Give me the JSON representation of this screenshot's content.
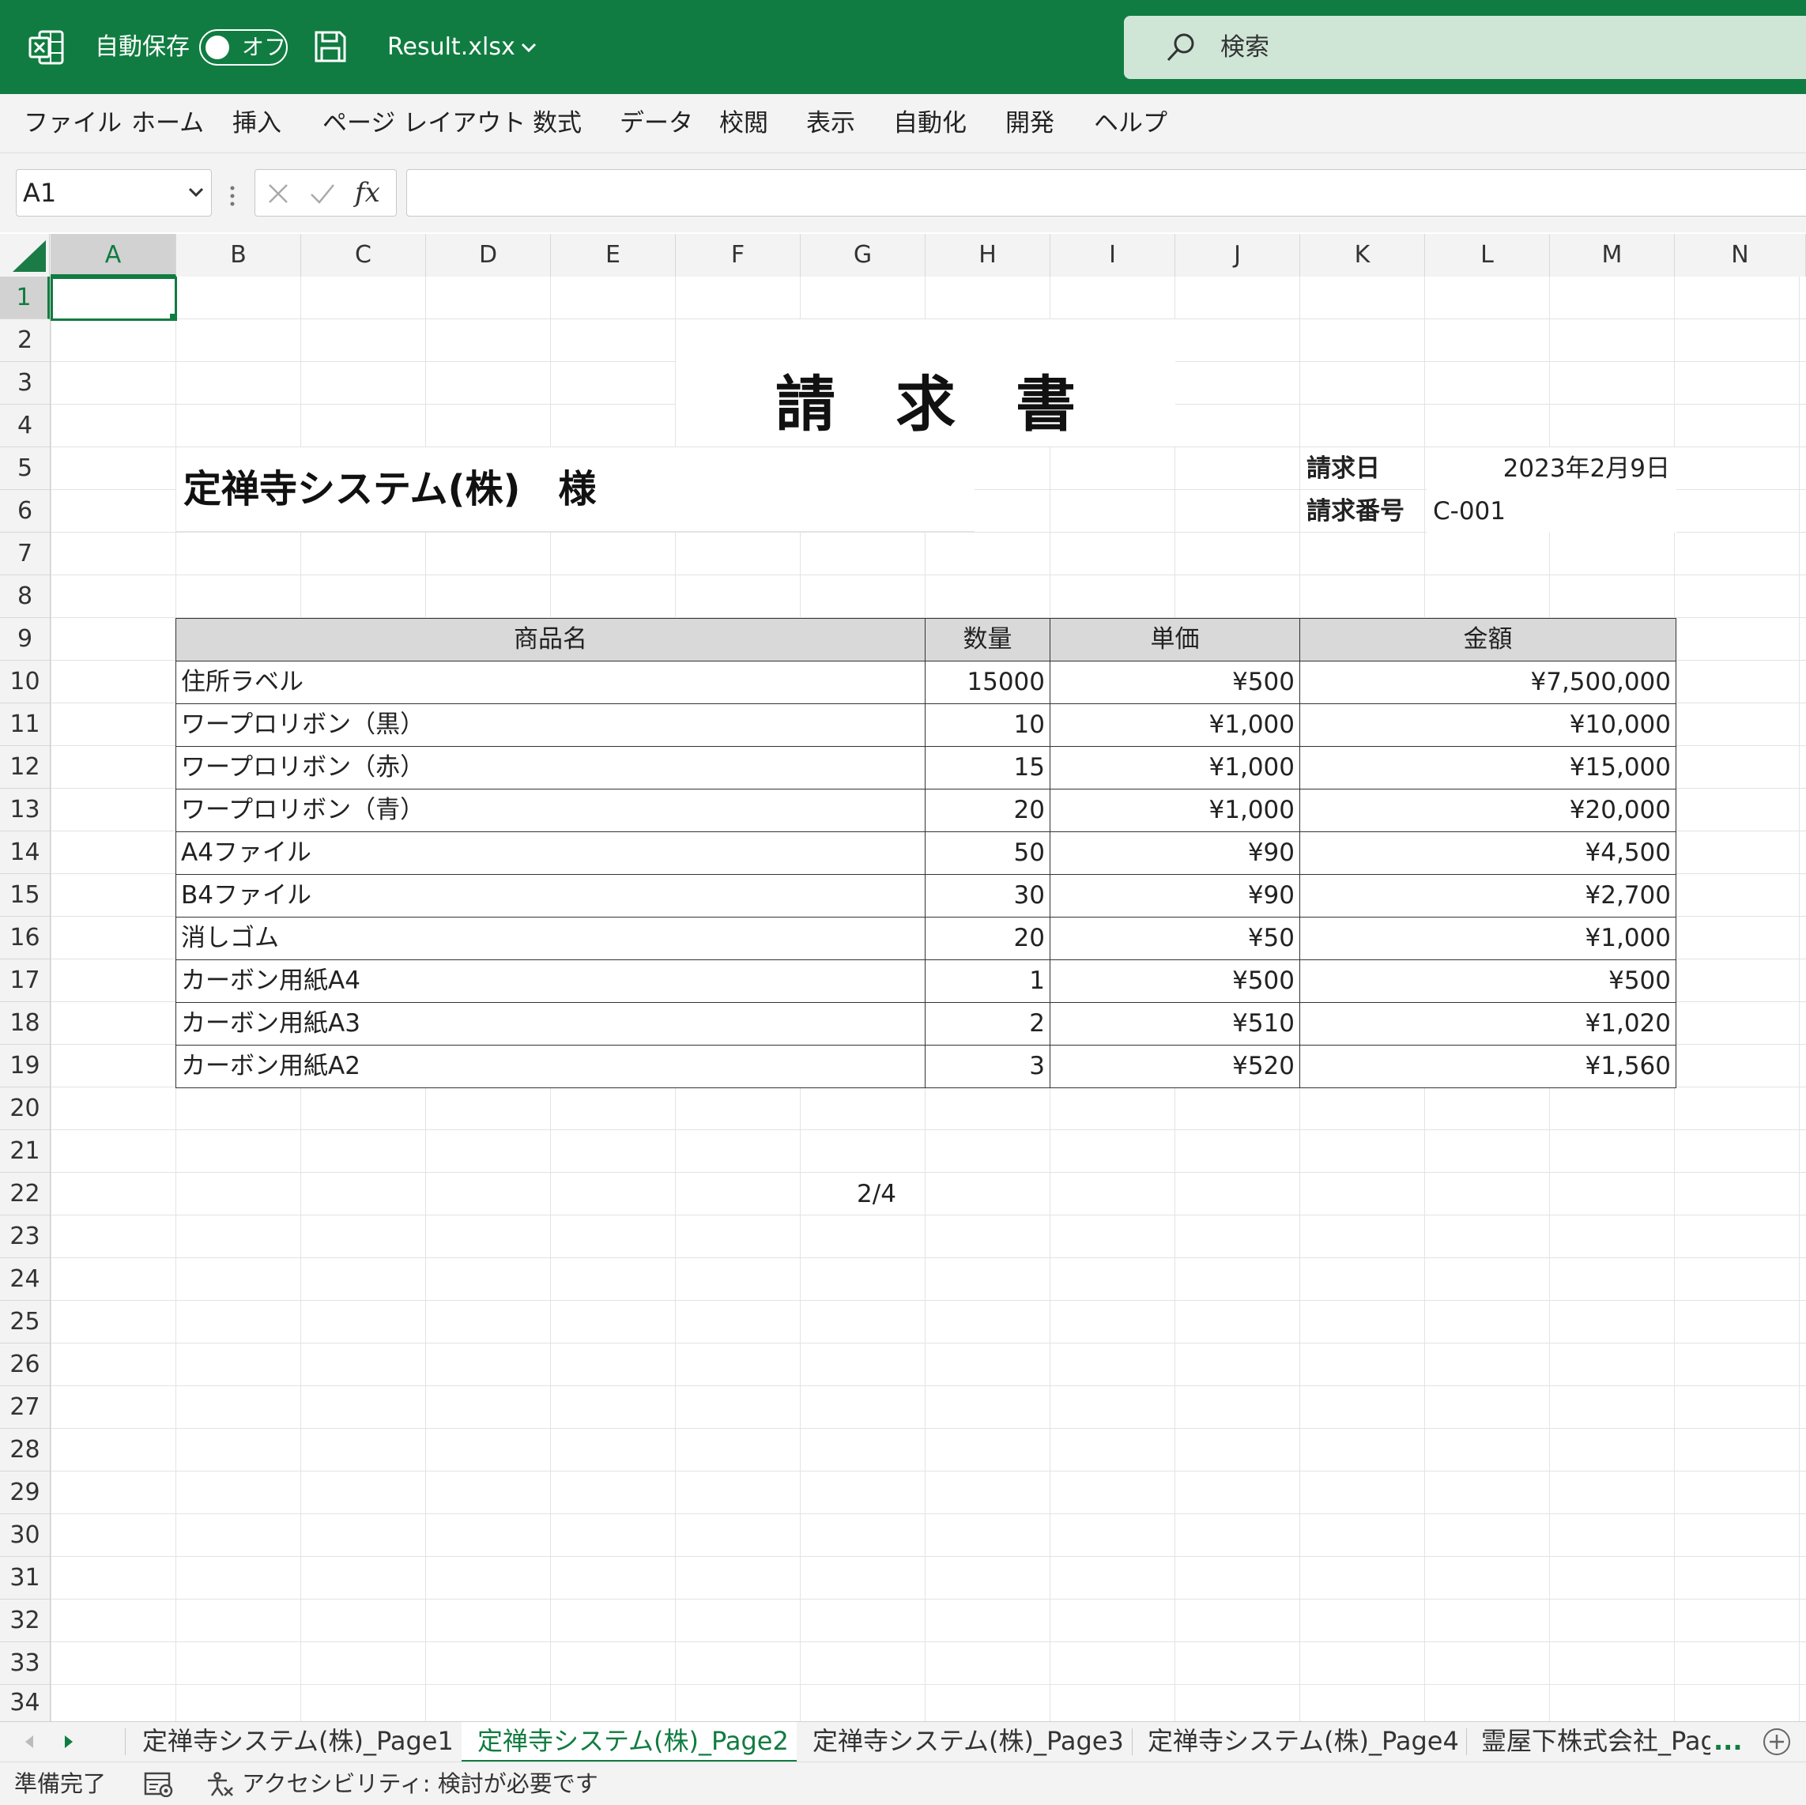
{
  "titlebar": {
    "autosave_label": "自動保存",
    "autosave_state": "オフ",
    "filename": "Result.xlsx",
    "search_placeholder": "検索"
  },
  "menu": [
    "ファイル",
    "ホーム",
    "挿入",
    "ページ レイアウト",
    "数式",
    "データ",
    "校閲",
    "表示",
    "自動化",
    "開発",
    "ヘルプ"
  ],
  "formula_bar": {
    "name_box": "A1",
    "fx": "fx",
    "formula": ""
  },
  "columns": [
    "A",
    "B",
    "C",
    "D",
    "E",
    "F",
    "G",
    "H",
    "I",
    "J",
    "K",
    "L",
    "M",
    "N"
  ],
  "rows": [
    "1",
    "2",
    "3",
    "4",
    "5",
    "6",
    "7",
    "8",
    "9",
    "10",
    "11",
    "12",
    "13",
    "14",
    "15",
    "16",
    "17",
    "18",
    "19",
    "20",
    "21",
    "22",
    "23",
    "24",
    "25",
    "26",
    "27",
    "28",
    "29",
    "30",
    "31",
    "32",
    "33",
    "34"
  ],
  "sheet": {
    "title": "請　求　書",
    "customer": "定禅寺システム(株)　様",
    "invoice_date_label": "請求日",
    "invoice_date": "2023年2月9日",
    "invoice_no_label": "請求番号",
    "invoice_no": "C-001",
    "table_headers": [
      "商品名",
      "数量",
      "単価",
      "金額"
    ],
    "table_rows": [
      [
        "住所ラベル",
        "15000",
        "¥500",
        "¥7,500,000"
      ],
      [
        "ワープロリボン（黒）",
        "10",
        "¥1,000",
        "¥10,000"
      ],
      [
        "ワープロリボン（赤）",
        "15",
        "¥1,000",
        "¥15,000"
      ],
      [
        "ワープロリボン（青）",
        "20",
        "¥1,000",
        "¥20,000"
      ],
      [
        "A4ファイル",
        "50",
        "¥90",
        "¥4,500"
      ],
      [
        "B4ファイル",
        "30",
        "¥90",
        "¥2,700"
      ],
      [
        "消しゴム",
        "20",
        "¥50",
        "¥1,000"
      ],
      [
        "カーボン用紙A4",
        "1",
        "¥500",
        "¥500"
      ],
      [
        "カーボン用紙A3",
        "2",
        "¥510",
        "¥1,020"
      ],
      [
        "カーボン用紙A2",
        "3",
        "¥520",
        "¥1,560"
      ]
    ],
    "page_number": "2/4"
  },
  "tabs": [
    "定禅寺システム(株)_Page1",
    "定禅寺システム(株)_Page2",
    "定禅寺システム(株)_Page3",
    "定禅寺システム(株)_Page4",
    "霊屋下株式会社_Pag"
  ],
  "tabs_more": "...",
  "active_tab_index": 1,
  "status": {
    "ready": "準備完了",
    "accessibility": "アクセシビリティ: 検討が必要です"
  },
  "colors": {
    "excel_green": "#107c41",
    "header_fill": "#d9d9d9"
  }
}
